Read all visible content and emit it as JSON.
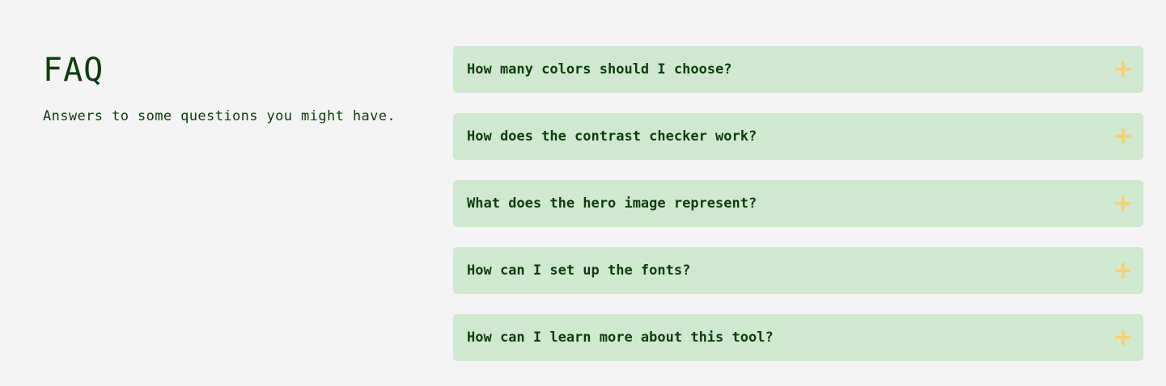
{
  "intro": {
    "title": "FAQ",
    "subtitle": "Answers to some questions you might have."
  },
  "faq": {
    "items": [
      {
        "question": "How many colors should I choose?"
      },
      {
        "question": "How does the contrast checker work?"
      },
      {
        "question": "What does the hero image represent?"
      },
      {
        "question": "How can I set up the fonts?"
      },
      {
        "question": "How can I learn more about this tool?"
      }
    ]
  },
  "colors": {
    "background": "#f4f4f4",
    "text": "#0e3d0b",
    "item_background": "#d0e8d0",
    "icon": "#f3d27a"
  },
  "icons": {
    "expand": "plus-icon"
  }
}
